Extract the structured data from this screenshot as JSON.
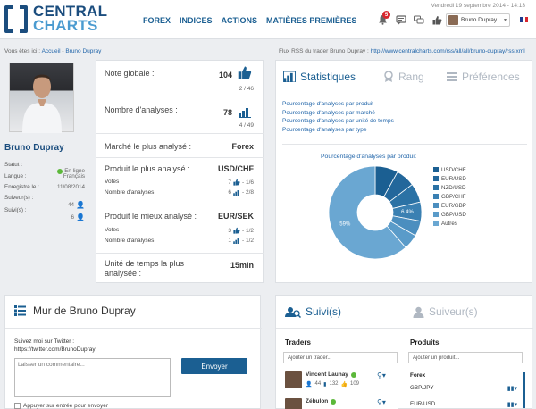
{
  "header": {
    "logo_line1": "CENTRAL",
    "logo_line2": "CHARTS",
    "nav": [
      "FOREX",
      "INDICES",
      "ACTIONS",
      "MATIÈRES PREMIÈRES"
    ],
    "date": "Vendredi 19 septembre 2014 - 14:13",
    "notification_count": "5",
    "user_name": "Bruno Dupray",
    "icons": [
      "bell-icon",
      "chat-icon",
      "thumbs-up-icon",
      "flag-fr-icon"
    ]
  },
  "breadcrumb": {
    "prefix": "Vous êtes ici :",
    "home": "Accueil",
    "separator": " - ",
    "current": "Bruno Dupray"
  },
  "rss": {
    "label": "Flux RSS du trader Bruno Dupray :",
    "url": "http://www.centralcharts.com/rss/all/all/bruno-dupray/rss.xml"
  },
  "profile": {
    "name": "Bruno Dupray",
    "rows": [
      {
        "label": "Statut :",
        "value": "En ligne"
      },
      {
        "label": "Langue :",
        "value": "Français"
      },
      {
        "label": "Enregistré le :",
        "value": "11/08/2014"
      },
      {
        "label": "Suiveur(s) :",
        "value": "44"
      },
      {
        "label": "Suivi(s) :",
        "value": "6"
      }
    ]
  },
  "stats": {
    "note_label": "Note globale :",
    "note_value": "104",
    "note_rank": "2 / 46",
    "analyses_label": "Nombre d'analyses :",
    "analyses_value": "78",
    "analyses_rank": "4 / 49",
    "market_label": "Marché le plus analysé :",
    "market_value": "Forex",
    "product_label": "Produit le plus analysé :",
    "product_value": "USD/CHF",
    "product_votes_label": "Votes",
    "product_votes": "7",
    "product_votes_score": "- 1/6",
    "product_analyses_label": "Nombre d'analyses",
    "product_analyses": "6",
    "product_analyses_score": "- 2/8",
    "best_label": "Produit le mieux analysé :",
    "best_value": "EUR/SEK",
    "best_votes_label": "Votes",
    "best_votes": "3",
    "best_votes_score": "- 1/2",
    "best_analyses_label": "Nombre d'analyses",
    "best_analyses": "1",
    "best_analyses_score": "- 1/2",
    "time_label": "Unité de temps la plus analysée :",
    "time_value": "15min"
  },
  "right_tabs": [
    "Statistiques",
    "Rang",
    "Préférences"
  ],
  "right_links": [
    "Pourcentage d'analyses par produit",
    "Pourcentage d'analyses par marché",
    "Pourcentage d'analyses par unité de temps",
    "Pourcentage d'analyses par type"
  ],
  "chart_data": {
    "type": "pie",
    "title": "Pourcentage d'analyses par produit",
    "labels": [
      "USD/CHF",
      "EUR/USD",
      "NZD/USD",
      "GBP/CHF",
      "EUR/GBP",
      "GBP/USD",
      "Autres"
    ],
    "values": [
      7.7,
      6.4,
      6.4,
      6.4,
      5.1,
      5.1,
      59.0
    ],
    "colors": [
      "#1b5f92",
      "#23679b",
      "#2b72a5",
      "#3a80b2",
      "#4b8ebf",
      "#5a9bc9",
      "#6aa7d2"
    ],
    "data_labels": [
      "",
      "",
      "",
      "6.4%",
      "",
      "",
      "59%"
    ]
  },
  "wall": {
    "title": "Mur de Bruno Dupray",
    "twitter_line1": "Suivez moi sur Twitter :",
    "twitter_line2": "https://twitter.com/BrunoDupray",
    "comment_placeholder": "Laisser un commentaire...",
    "send_label": "Envoyer",
    "checkbox_label": "Appuyer sur entrée pour envoyer"
  },
  "follow": {
    "tab1": "Suivi(s)",
    "tab2": "Suiveur(s)",
    "traders_heading": "Traders",
    "products_heading": "Produits",
    "trader_placeholder": "Ajouter un trader...",
    "product_placeholder": "Ajouter un produit...",
    "traders": [
      {
        "name": "Vincent Launay",
        "a": "44",
        "b": "132",
        "c": "109",
        "online": true
      },
      {
        "name": "Zébulon",
        "online": true
      }
    ],
    "products_group": "Forex",
    "products": [
      "GBP/JPY",
      "EUR/USD"
    ]
  }
}
